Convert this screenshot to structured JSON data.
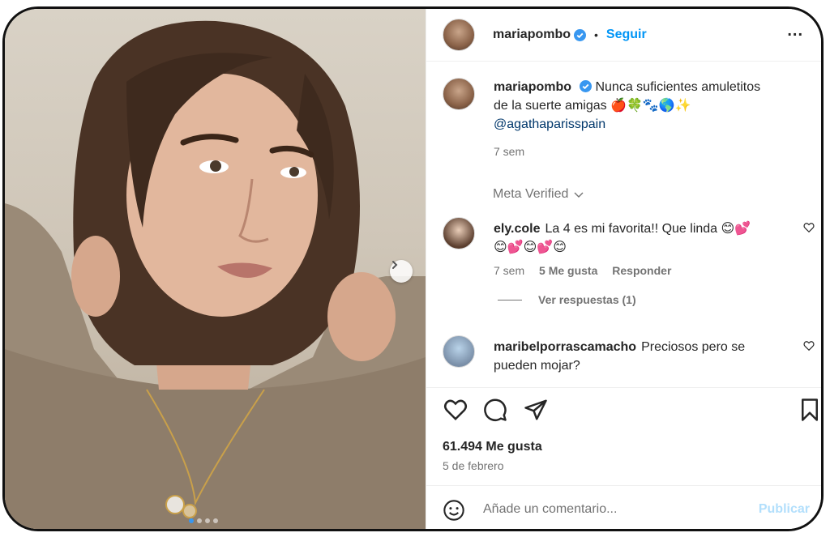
{
  "post": {
    "username": "mariapombo",
    "separator": "•",
    "follow_label": "Seguir",
    "more_label": "...",
    "caption_line1": "Nunca suficientes amuletitos",
    "caption_line2": "de la suerte amigas 🍎🍀🐾🌎✨",
    "caption_mention": "@agathaparisspain",
    "caption_time": "7 sem",
    "meta_verified": "Meta Verified",
    "likes": "61.494 Me gusta",
    "date": "5 de febrero",
    "comment_placeholder": "Añade un comentario...",
    "publish_label": "Publicar"
  },
  "comments": [
    {
      "username": "ely.cole",
      "line1": "La 4 es mi favorita!! Que linda 😊💕",
      "line2": "😊💕😊💕😊",
      "time": "7 sem",
      "likes": "5 Me gusta",
      "reply": "Responder",
      "view_replies": "Ver respuestas (1)"
    },
    {
      "username": "maribelporrascamacho",
      "line1": "Preciosos pero se",
      "line2": "pueden mojar?"
    }
  ],
  "colors": {
    "accent": "#0095f6",
    "verified": "#3897f0",
    "text": "#262626",
    "muted": "#737373"
  },
  "icons": [
    "verified-badge-icon",
    "more-icon",
    "heart-icon",
    "comment-icon",
    "share-icon",
    "bookmark-icon",
    "emoji-icon",
    "carousel-next-icon"
  ]
}
